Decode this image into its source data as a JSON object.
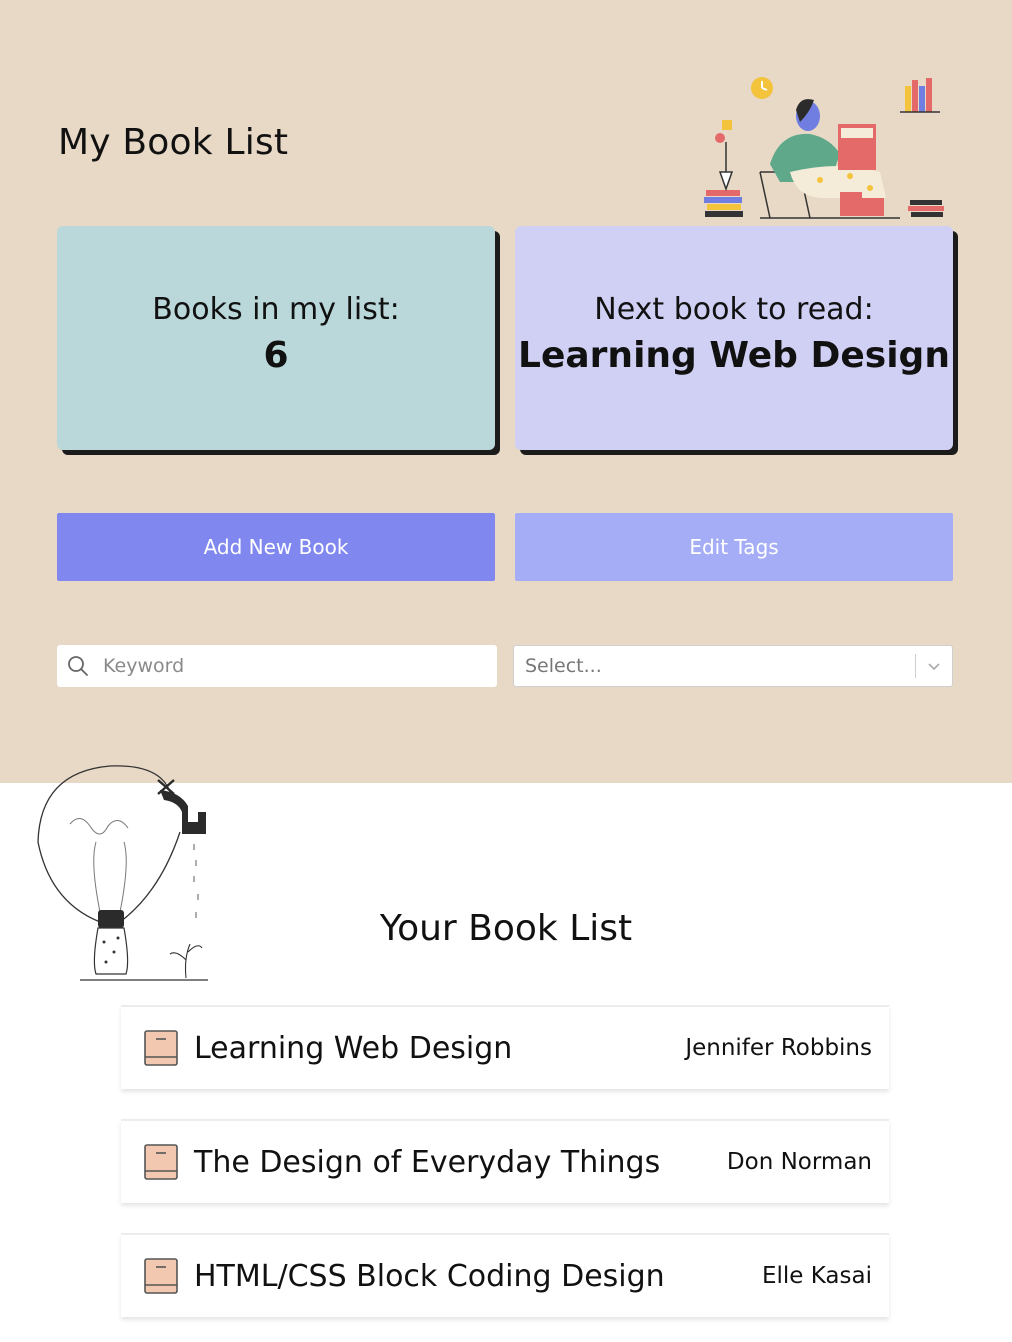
{
  "header": {
    "title": "My Book List"
  },
  "stats": {
    "count_label": "Books in my list:",
    "count_value": "6",
    "next_label": "Next book to read:",
    "next_value": "Learning Web Design"
  },
  "actions": {
    "add_label": "Add New Book",
    "edit_label": "Edit Tags"
  },
  "filters": {
    "search_placeholder": "Keyword",
    "search_icon": "search-icon",
    "select_value": "Select...",
    "select_icon": "chevron-down-icon"
  },
  "list": {
    "title": "Your Book List",
    "books": [
      {
        "title": "Learning Web Design",
        "author": "Jennifer Robbins"
      },
      {
        "title": "The Design of Everyday Things",
        "author": "Don Norman"
      },
      {
        "title": "HTML/CSS Block Coding Design",
        "author": "Elle Kasai"
      }
    ]
  },
  "colors": {
    "top_background": "#e8d9c6",
    "count_card": "#bad8d9",
    "next_card": "#cfd0f3",
    "add_button": "#8088ef",
    "edit_button": "#a5adf6",
    "book_icon": "#f2c9b0"
  }
}
